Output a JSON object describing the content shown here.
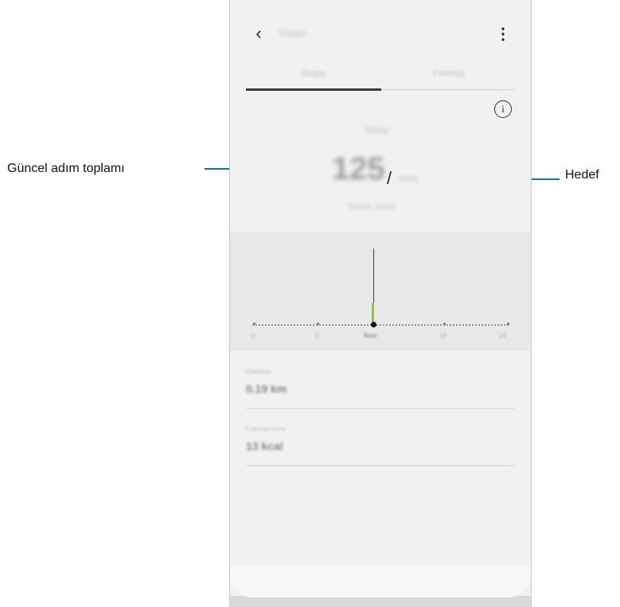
{
  "annotations": {
    "left_label": "Güncel adım toplamı",
    "right_label": "Hedef"
  },
  "app": {
    "title": "Steps",
    "menu_icon": "more-vert-icon",
    "back_icon": "chevron-left-icon"
  },
  "tabs": [
    {
      "label": "Steps",
      "active": true
    },
    {
      "label": "Friends",
      "active": false
    }
  ],
  "summary": {
    "date_label": "Today",
    "current_steps": "125",
    "separator": "/",
    "goal_steps": "6000",
    "time_label": "Since reset"
  },
  "chart_data": {
    "type": "bar",
    "x_ticks": [
      "0",
      "6",
      "Now",
      "18",
      "24"
    ],
    "current_marker": "Now"
  },
  "stats": [
    {
      "label": "Distance",
      "value": "0.19 km"
    },
    {
      "label": "Calories burnt",
      "value": "13 kcal"
    }
  ]
}
